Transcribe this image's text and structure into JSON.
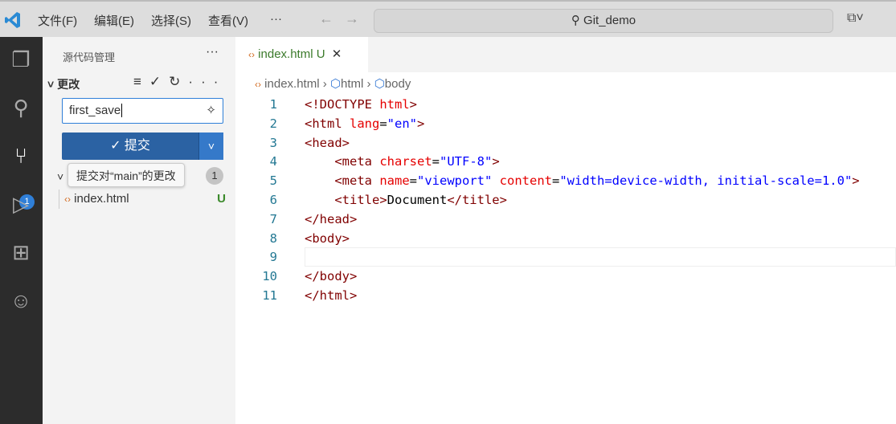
{
  "menu": [
    "文件(F)",
    "编辑(E)",
    "选择(S)",
    "查看(V)",
    "···"
  ],
  "search": "Git_demo",
  "activity_badge": "1",
  "sidebar": {
    "title": "源代码管理",
    "section": "更改",
    "commit_input": "first_save",
    "commit_button": "提交",
    "tooltip": "提交对“main”的更改",
    "changes_count": "1",
    "file": "index.html",
    "file_status": "U"
  },
  "tab": {
    "label": "index.html",
    "status": "U"
  },
  "breadcrumb": [
    "index.html",
    "html",
    "body"
  ],
  "code": [
    [
      [
        "t",
        "<!DOCTYPE "
      ],
      [
        "a",
        "html"
      ],
      [
        "t",
        ">"
      ]
    ],
    [
      [
        "t",
        "<html "
      ],
      [
        "a",
        "lang"
      ],
      [
        "p",
        "="
      ],
      [
        "v",
        "\"en\""
      ],
      [
        "t",
        ">"
      ]
    ],
    [
      [
        "t",
        "<head>"
      ]
    ],
    [
      [
        "p",
        "    "
      ],
      [
        "t",
        "<meta "
      ],
      [
        "a",
        "charset"
      ],
      [
        "p",
        "="
      ],
      [
        "v",
        "\"UTF-8\""
      ],
      [
        "t",
        ">"
      ]
    ],
    [
      [
        "p",
        "    "
      ],
      [
        "t",
        "<meta "
      ],
      [
        "a",
        "name"
      ],
      [
        "p",
        "="
      ],
      [
        "v",
        "\"viewport\""
      ],
      [
        "p",
        " "
      ],
      [
        "a",
        "content"
      ],
      [
        "p",
        "="
      ],
      [
        "v",
        "\"width=device-width, initial-scale=1.0\""
      ],
      [
        "t",
        ">"
      ]
    ],
    [
      [
        "p",
        "    "
      ],
      [
        "t",
        "<title>"
      ],
      [
        "p",
        "Document"
      ],
      [
        "t",
        "</title>"
      ]
    ],
    [
      [
        "t",
        "</head>"
      ]
    ],
    [
      [
        "t",
        "<body>"
      ]
    ],
    [],
    [
      [
        "t",
        "</body>"
      ]
    ],
    [
      [
        "t",
        "</html>"
      ]
    ]
  ]
}
